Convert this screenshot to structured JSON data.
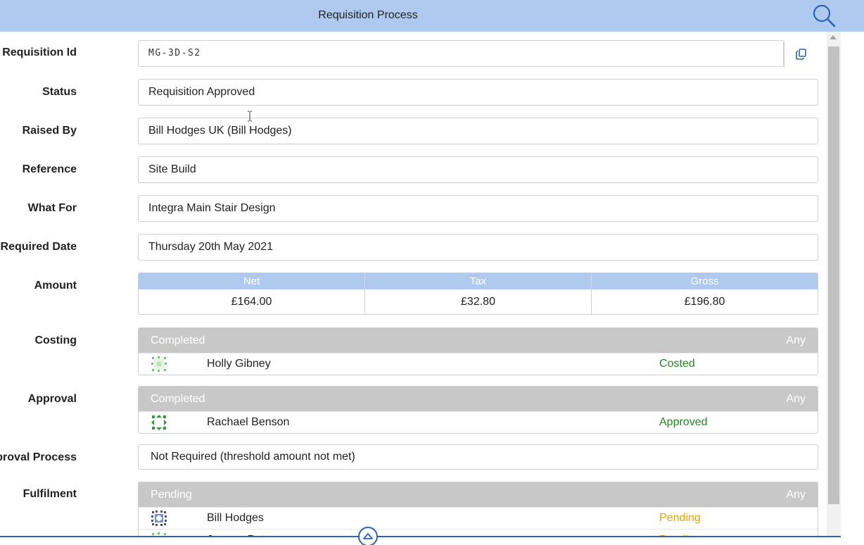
{
  "header": {
    "title": "Requisition Process",
    "search_icon": "search-icon"
  },
  "fields": {
    "requisition_id": {
      "label": "Requisition Id",
      "value": "MG-3D-S2",
      "copy_icon": "copy-icon"
    },
    "status": {
      "label": "Status",
      "value": "Requisition Approved"
    },
    "raised_by": {
      "label": "Raised By",
      "value": "Bill Hodges UK (Bill Hodges)"
    },
    "reference": {
      "label": "Reference",
      "value": "Site Build"
    },
    "what_for": {
      "label": "What For",
      "value": "Integra Main Stair Design"
    },
    "required_date": {
      "label": "Required Date",
      "value": "Thursday 20th May 2021"
    },
    "approval_process": {
      "label": "Approval Process",
      "value": "Not Required (threshold amount not met)"
    }
  },
  "amount": {
    "label": "Amount",
    "headers": [
      "Net",
      "Tax",
      "Gross"
    ],
    "values": [
      "£164.00",
      "£32.80",
      "£196.80"
    ]
  },
  "costing": {
    "label": "Costing",
    "state": "Completed",
    "scope": "Any",
    "rows": [
      {
        "name": "Holly Gibney",
        "status": "Costed",
        "status_color": "#1e8a1e"
      }
    ]
  },
  "approval": {
    "label": "Approval",
    "state": "Completed",
    "scope": "Any",
    "rows": [
      {
        "name": "Rachael Benson",
        "status": "Approved",
        "status_color": "#1e8a1e"
      }
    ]
  },
  "fulfilment": {
    "label": "Fulfilment",
    "state": "Pending",
    "scope": "Any",
    "rows": [
      {
        "name": "Bill Hodges",
        "status": "Pending",
        "status_color": "#f0a000"
      },
      {
        "name": "Jerome Peterson",
        "status": "Pending",
        "status_color": "#f0a000"
      }
    ]
  },
  "colors": {
    "header_bg": "#b0c9ee",
    "panel_header_bg": "#c8c8c8",
    "accent": "#2a62b6"
  }
}
